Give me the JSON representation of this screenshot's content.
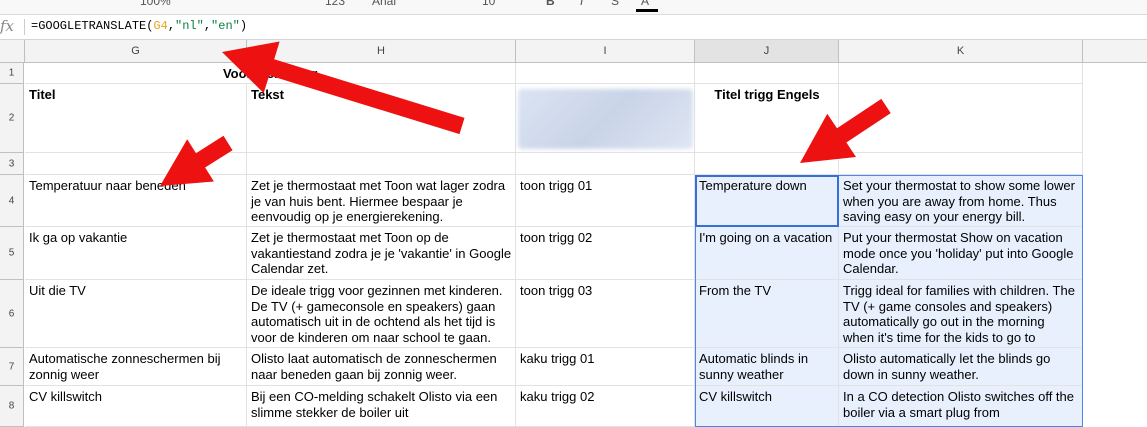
{
  "toolbar": {
    "items": [
      "100%",
      "123",
      "Arial",
      "10",
      "B",
      "I",
      "S",
      "A"
    ]
  },
  "formula_bar": {
    "fx": "fx",
    "prefix": "=GOOGLETRANSLATE(",
    "ref": "G4",
    "sep1": ",",
    "src": "\"nl\"",
    "sep2": ",",
    "dst": "\"en\"",
    "suffix": ")"
  },
  "columns": [
    "G",
    "H",
    "I",
    "J",
    "K"
  ],
  "rows": [
    "1",
    "2",
    "3",
    "4",
    "5",
    "6",
    "7",
    "8"
  ],
  "header": {
    "merged_title": "Voorbeeld trigg",
    "titel": "Titel",
    "tekst": "Tekst",
    "titel_engels": "Titel trigg Engels"
  },
  "data_rows": [
    {
      "titel": "Temperatuur naar beneden",
      "tekst": "Zet je thermostaat met Toon wat lager zodra je van huis bent. Hiermee bespaar je eenvoudig op je energierekening.",
      "id": "toon trigg 01",
      "titel_en": "Temperature down",
      "tekst_en": "Set your thermostat to show some lower when you are away from home. Thus saving easy on your energy bill."
    },
    {
      "titel": "Ik ga op vakantie",
      "tekst": "Zet je thermostaat met Toon op de vakantiestand zodra je je 'vakantie' in Google Calendar zet.",
      "id": "toon trigg 02",
      "titel_en": "I'm going on a vacation",
      "tekst_en": "Put your thermostat Show on vacation mode once you 'holiday' put into Google Calendar."
    },
    {
      "titel": "Uit die TV",
      "tekst": "De ideale trigg voor gezinnen met kinderen. De TV (+ gameconsole en speakers) gaan automatisch uit in de ochtend als het tijd is voor de kinderen om naar school te gaan.",
      "id": "toon trigg 03",
      "titel_en": "From the TV",
      "tekst_en": "Trigg ideal for families with children. The TV (+ game consoles and speakers) automatically go out in the morning when it's time for the kids to go to school."
    },
    {
      "titel": "Automatische zonneschermen bij zonnig weer",
      "tekst": "Olisto laat automatisch de zonneschermen naar beneden gaan bij zonnig weer.",
      "id": "kaku trigg 01",
      "titel_en": "Automatic blinds in sunny weather",
      "tekst_en": "Olisto automatically let the blinds go down in sunny weather."
    },
    {
      "titel": "CV killswitch",
      "tekst": "Bij een CO-melding schakelt Olisto via een slimme stekker de boiler uit",
      "id": "kaku trigg 02",
      "titel_en": "CV killswitch",
      "tekst_en": "In a CO detection Olisto switches off the boiler via a smart plug from"
    }
  ],
  "colors": {
    "arrow": "#ee1111",
    "selection": "#e8f0fe",
    "selection_border": "#4a86e8",
    "formula_ref": "#e6a51e",
    "formula_str": "#0b8043"
  }
}
